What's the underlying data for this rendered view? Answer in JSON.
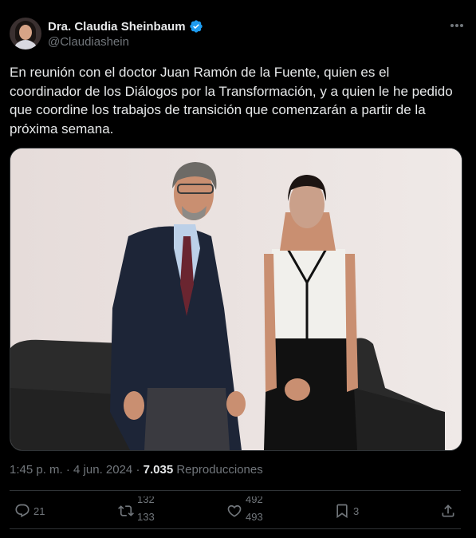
{
  "user": {
    "name": "Dra. Claudia Sheinbaum",
    "handle": "@Claudiashein"
  },
  "tweet": {
    "text": "En reunión con el doctor Juan Ramón de la Fuente, quien es el coordinador de los Diálogos por la Transformación, y a quien le he pedido que coordine los trabajos de transición que comenzarán a partir de la próxima semana."
  },
  "meta": {
    "time": "1:45 p. m.",
    "separator": "·",
    "date": "4 jun. 2024",
    "views_count": "7.035",
    "views_label": "Reproducciones"
  },
  "actions": {
    "reply_count": "21",
    "retweet_count_prev": "132",
    "retweet_count": "133",
    "like_count_prev": "492",
    "like_count": "493",
    "bookmark_count": "3"
  },
  "icons": {
    "verified": "verified-badge-icon",
    "more": "more-icon",
    "reply": "reply-icon",
    "retweet": "retweet-icon",
    "like": "heart-icon",
    "bookmark": "bookmark-icon",
    "share": "share-icon"
  },
  "colors": {
    "background": "#000000",
    "text": "#e7e9ea",
    "secondary": "#71767b",
    "verified": "#1d9bf0",
    "divider": "#2f3336"
  }
}
